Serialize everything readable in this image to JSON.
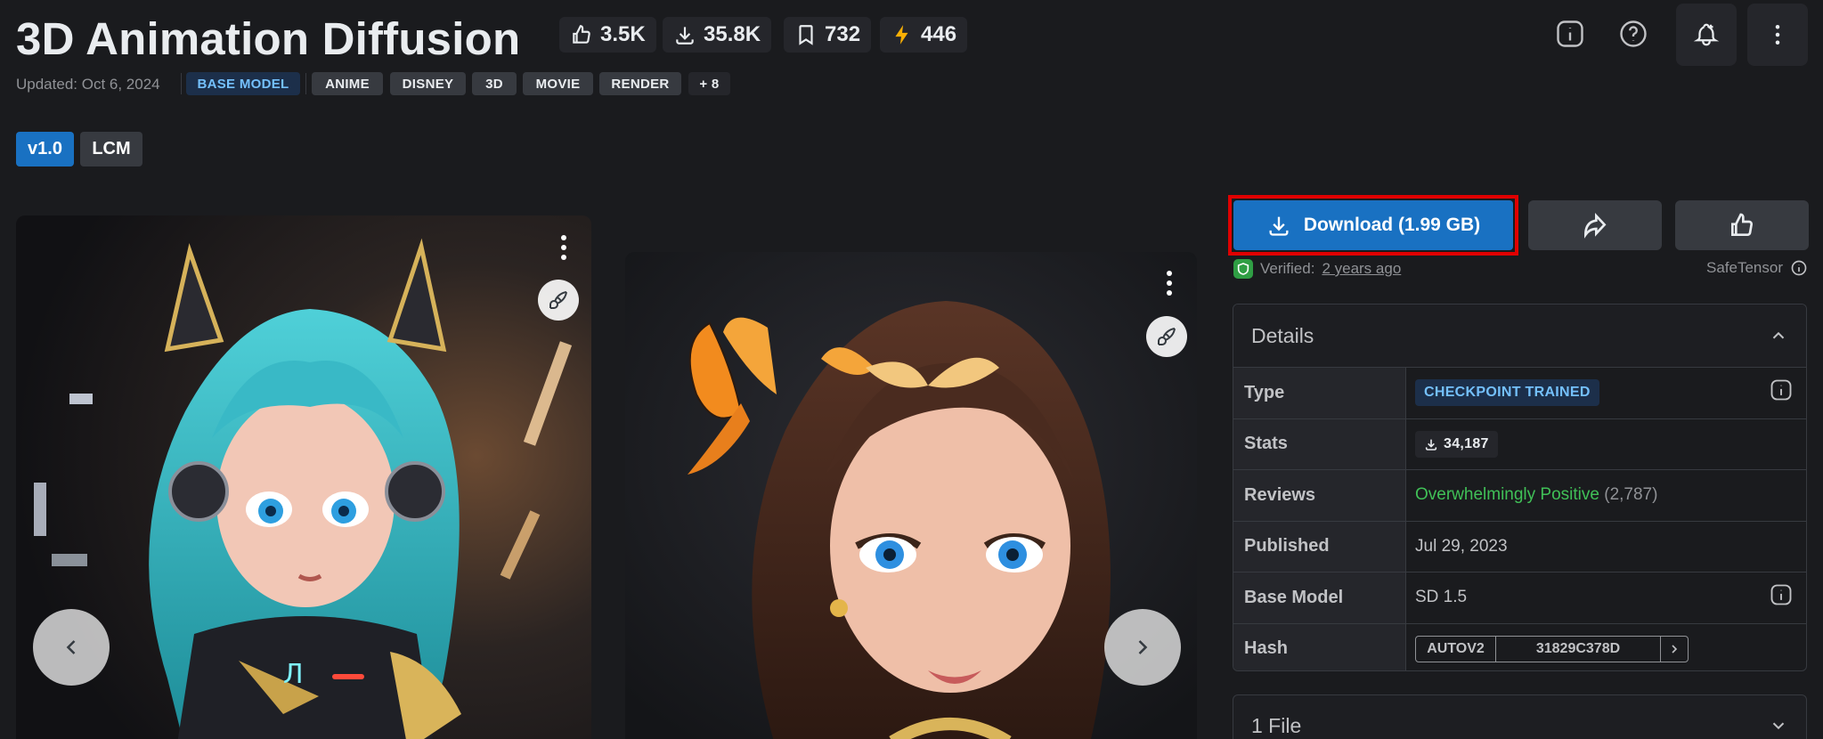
{
  "header": {
    "title": "3D Animation Diffusion",
    "stats": {
      "likes": "3.5K",
      "downloads": "35.8K",
      "bookmarks": "732",
      "buzz": "446"
    },
    "updated": "Updated: Oct 6, 2024",
    "base_badge": "BASE MODEL",
    "tags": [
      "ANIME",
      "DISNEY",
      "3D",
      "MOVIE",
      "RENDER"
    ],
    "more_tags": "+ 8",
    "accent": "#1971c2"
  },
  "versions": [
    {
      "label": "v1.0",
      "active": true
    },
    {
      "label": "LCM",
      "active": false
    }
  ],
  "gallery": {
    "images": [
      {
        "alt": "teal-haired anime girl with headphones and robotic armor"
      },
      {
        "alt": "brown-haired woman with butterflies"
      }
    ]
  },
  "actions": {
    "download": "Download (1.99 GB)",
    "verified_prefix": "Verified:",
    "verified_time": "2 years ago",
    "safetensor": "SafeTensor"
  },
  "details": {
    "title": "Details",
    "rows": {
      "type": {
        "label": "Type",
        "value": "CHECKPOINT TRAINED"
      },
      "stats": {
        "label": "Stats",
        "value": "34,187"
      },
      "reviews": {
        "label": "Reviews",
        "value": "Overwhelmingly Positive",
        "count": "(2,787)"
      },
      "published": {
        "label": "Published",
        "value": "Jul 29, 2023"
      },
      "base_model": {
        "label": "Base Model",
        "value": "SD 1.5"
      },
      "hash": {
        "label": "Hash",
        "algo": "AUTOV2",
        "value": "31829C378D"
      }
    }
  },
  "files": {
    "title": "1 File"
  }
}
